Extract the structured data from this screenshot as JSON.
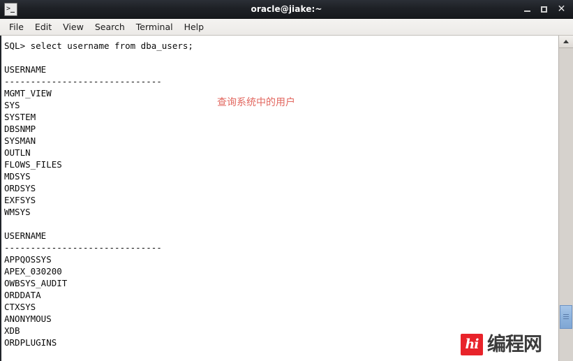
{
  "window": {
    "title": "oracle@jiake:~",
    "icon": "terminal-icon",
    "controls": {
      "minimize": "–",
      "maximize": "□",
      "close": "✕"
    }
  },
  "menubar": {
    "items": [
      {
        "label": "File"
      },
      {
        "label": "Edit"
      },
      {
        "label": "View"
      },
      {
        "label": "Search"
      },
      {
        "label": "Terminal"
      },
      {
        "label": "Help"
      }
    ]
  },
  "terminal": {
    "content": "SQL> select username from dba_users;\n\nUSERNAME\n------------------------------\nMGMT_VIEW\nSYS\nSYSTEM\nDBSNMP\nSYSMAN\nOUTLN\nFLOWS_FILES\nMDSYS\nORDSYS\nEXFSYS\nWMSYS\n\nUSERNAME\n------------------------------\nAPPQOSSYS\nAPEX_030200\nOWBSYS_AUDIT\nORDDATA\nCTXSYS\nANONYMOUS\nXDB\nORDPLUGINS",
    "prompt": "SQL>",
    "command": "select username from dba_users;",
    "column_header": "USERNAME",
    "separator": "------------------------------",
    "block_one": [
      "MGMT_VIEW",
      "SYS",
      "SYSTEM",
      "DBSNMP",
      "SYSMAN",
      "OUTLN",
      "FLOWS_FILES",
      "MDSYS",
      "ORDSYS",
      "EXFSYS",
      "WMSYS"
    ],
    "block_two": [
      "APPQOSSYS",
      "APEX_030200",
      "OWBSYS_AUDIT",
      "ORDDATA",
      "CTXSYS",
      "ANONYMOUS",
      "XDB",
      "ORDPLUGINS"
    ],
    "annotation": {
      "text": "查询系统中的用户",
      "color": "#e2675f"
    },
    "colors": {
      "background": "#ffffff",
      "foreground": "#0a0a0a"
    }
  },
  "watermark": {
    "logo_mark": "hi",
    "text": "编程网",
    "color": "#e8232a"
  }
}
